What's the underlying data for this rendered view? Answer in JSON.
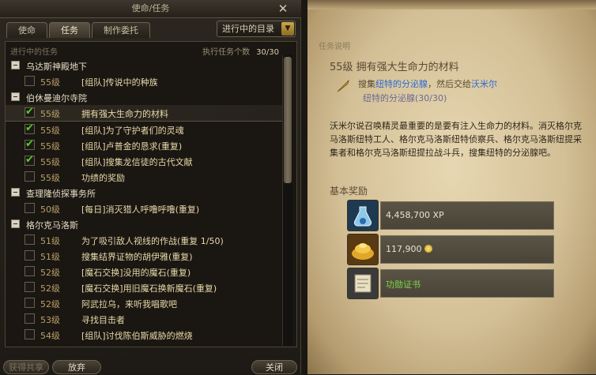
{
  "window": {
    "title": "使命/任务",
    "close_icon": "close-icon"
  },
  "tabs": [
    {
      "label": "使命",
      "active": false
    },
    {
      "label": "任务",
      "active": true
    },
    {
      "label": "制作委托",
      "active": false
    }
  ],
  "filter": {
    "selected": "进行中的目录",
    "arrow_icon": "chevron-down-icon"
  },
  "list_header": {
    "left": "进行中的任务",
    "count_label": "执行任务个数",
    "count_value": "30/30"
  },
  "categories": [
    {
      "name": "乌达斯神殿地下",
      "quests": [
        {
          "level": "55级",
          "name": "[组队]传说中的种族",
          "checked": false
        }
      ]
    },
    {
      "name": "伯休曼迪尔寺院",
      "quests": [
        {
          "level": "55级",
          "name": "拥有强大生命力的材料",
          "checked": true,
          "selected": true
        },
        {
          "level": "55级",
          "name": "[组队]为了守护者们的灵魂",
          "checked": true
        },
        {
          "level": "55级",
          "name": "[组队]卢普金的恳求(重复)",
          "checked": true
        },
        {
          "level": "55级",
          "name": "[组队]搜集龙信徒的古代文献",
          "checked": true
        },
        {
          "level": "55级",
          "name": "功绩的奖励",
          "checked": false
        }
      ]
    },
    {
      "name": "查理隆侦探事务所",
      "quests": [
        {
          "level": "50级",
          "name": "[每日]消灭猎人呼噜呼噜(重复)",
          "checked": false
        }
      ]
    },
    {
      "name": "格尔克马洛斯",
      "quests": [
        {
          "level": "51级",
          "name": "为了吸引敌人视线的作战(重复 1/50)",
          "checked": false
        },
        {
          "level": "51级",
          "name": "搜集结界证物的胡伊雅(重复)",
          "checked": false
        },
        {
          "level": "52级",
          "name": "[魔石交换]没用的魔石(重复)",
          "checked": false
        },
        {
          "level": "52级",
          "name": "[魔石交换]用旧魔石换新魔石(重复)",
          "checked": false
        },
        {
          "level": "52级",
          "name": "阿武拉乌，来听我唱歌吧",
          "checked": false
        },
        {
          "level": "53级",
          "name": "寻找目击者",
          "checked": false
        },
        {
          "level": "54级",
          "name": "[组队]讨伐陈伯斯威胁的燃烧",
          "checked": false
        }
      ]
    }
  ],
  "buttons": {
    "share": "获得共享",
    "abandon": "放弃",
    "close": "关闭"
  },
  "detail": {
    "section_label": "任务说明",
    "title": "55级 拥有强大生命力的材料",
    "objective": {
      "pre": "搜集",
      "item": "纽特的分泌腺",
      "mid": "，然后交给",
      "npc": "沃米尔"
    },
    "progress": "纽特的分泌腺(30/30)",
    "description": "沃米尔说召唤精灵最重要的是要有注入生命力的材料。消灭格尔克马洛斯纽特工人、格尔克马洛斯纽特侦察兵、格尔克马洛斯纽提采集者和格尔克马洛斯纽提拉战斗兵，搜集纽特的分泌腺吧。",
    "reward_label": "基本奖励",
    "rewards": [
      {
        "icon": "potion-icon",
        "value": "4,458,700 XP"
      },
      {
        "icon": "gold-pile-icon",
        "value": "117,900",
        "suffix_icon": "coin-icon"
      },
      {
        "icon": "scroll-icon",
        "value": "功勋证书"
      }
    ]
  },
  "colors": {
    "check": "#4fd12a",
    "link_blue": "#2a6ad4",
    "reward_green": "#7ed848",
    "level_gold": "#b8a068"
  }
}
